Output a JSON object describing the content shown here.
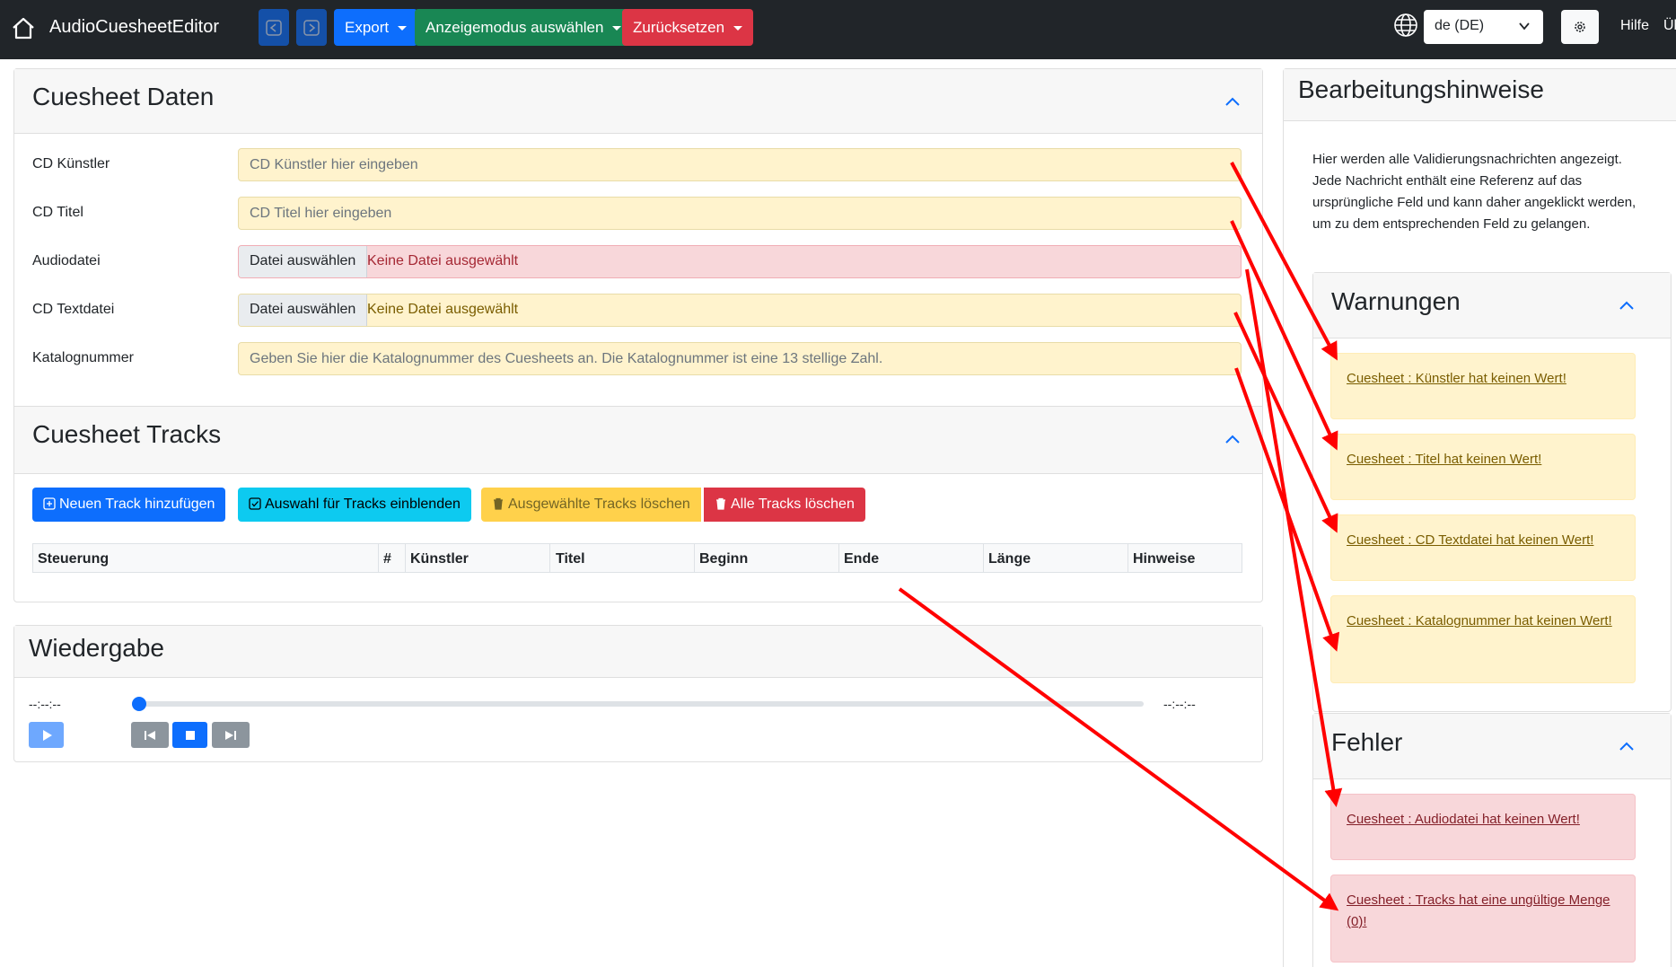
{
  "navbar": {
    "brand": "AudioCuesheetEditor",
    "export_label": "Export",
    "display_mode_label": "Anzeigemodus auswählen",
    "reset_label": "Zurücksetzen",
    "language": "de (DE)",
    "help_label": "Hilfe",
    "about_label": "Üb"
  },
  "cuesheet_data": {
    "title": "Cuesheet Daten",
    "fields": [
      {
        "label": "CD Künstler",
        "placeholder": "CD Künstler hier eingeben"
      },
      {
        "label": "CD Titel",
        "placeholder": "CD Titel hier eingeben"
      },
      {
        "label": "Audiodatei",
        "file_button": "Datei auswählen",
        "file_status": "Keine Datei ausgewählt"
      },
      {
        "label": "CD Textdatei",
        "file_button": "Datei auswählen",
        "file_status": "Keine Datei ausgewählt"
      },
      {
        "label": "Katalognummer",
        "placeholder": "Geben Sie hier die Katalognummer des Cuesheets an. Die Katalognummer ist eine 13 stellige Zahl."
      }
    ]
  },
  "tracks": {
    "title": "Cuesheet Tracks",
    "buttons": {
      "add": "Neuen Track hinzufügen",
      "select": "Auswahl für Tracks einblenden",
      "delete_selected": "Ausgewählte Tracks löschen",
      "delete_all": "Alle Tracks löschen"
    },
    "columns": [
      "Steuerung",
      "#",
      "Künstler",
      "Titel",
      "Beginn",
      "Ende",
      "Länge",
      "Hinweise"
    ]
  },
  "playback": {
    "title": "Wiedergabe",
    "current_time": "--:--:--",
    "total_time": "--:--:--",
    "progress": 0
  },
  "hints": {
    "title": "Bearbeitungshinweise",
    "description": "Hier werden alle Validierungsnachrichten angezeigt. Jede Nachricht enthält eine Referenz auf das ursprüngliche Feld und kann daher angeklickt werden, um zu dem entsprechenden Feld zu gelangen.",
    "warnings_title": "Warnungen",
    "warnings": [
      "Cuesheet : Künstler hat keinen Wert!",
      "Cuesheet : Titel hat keinen Wert!",
      "Cuesheet : CD Textdatei hat keinen Wert!",
      "Cuesheet : Katalognummer hat keinen Wert!"
    ],
    "errors_title": "Fehler",
    "errors": [
      "Cuesheet : Audiodatei hat keinen Wert!",
      "Cuesheet : Tracks hat eine ungültige Menge (0)!"
    ]
  },
  "colors": {
    "navbar": "#212529",
    "primary": "#0d6efd",
    "success": "#198754",
    "danger": "#dc3545",
    "warning_bg": "#fff3cd",
    "error_bg": "#f8d7da",
    "annotation_arrow": "#ff0000"
  }
}
